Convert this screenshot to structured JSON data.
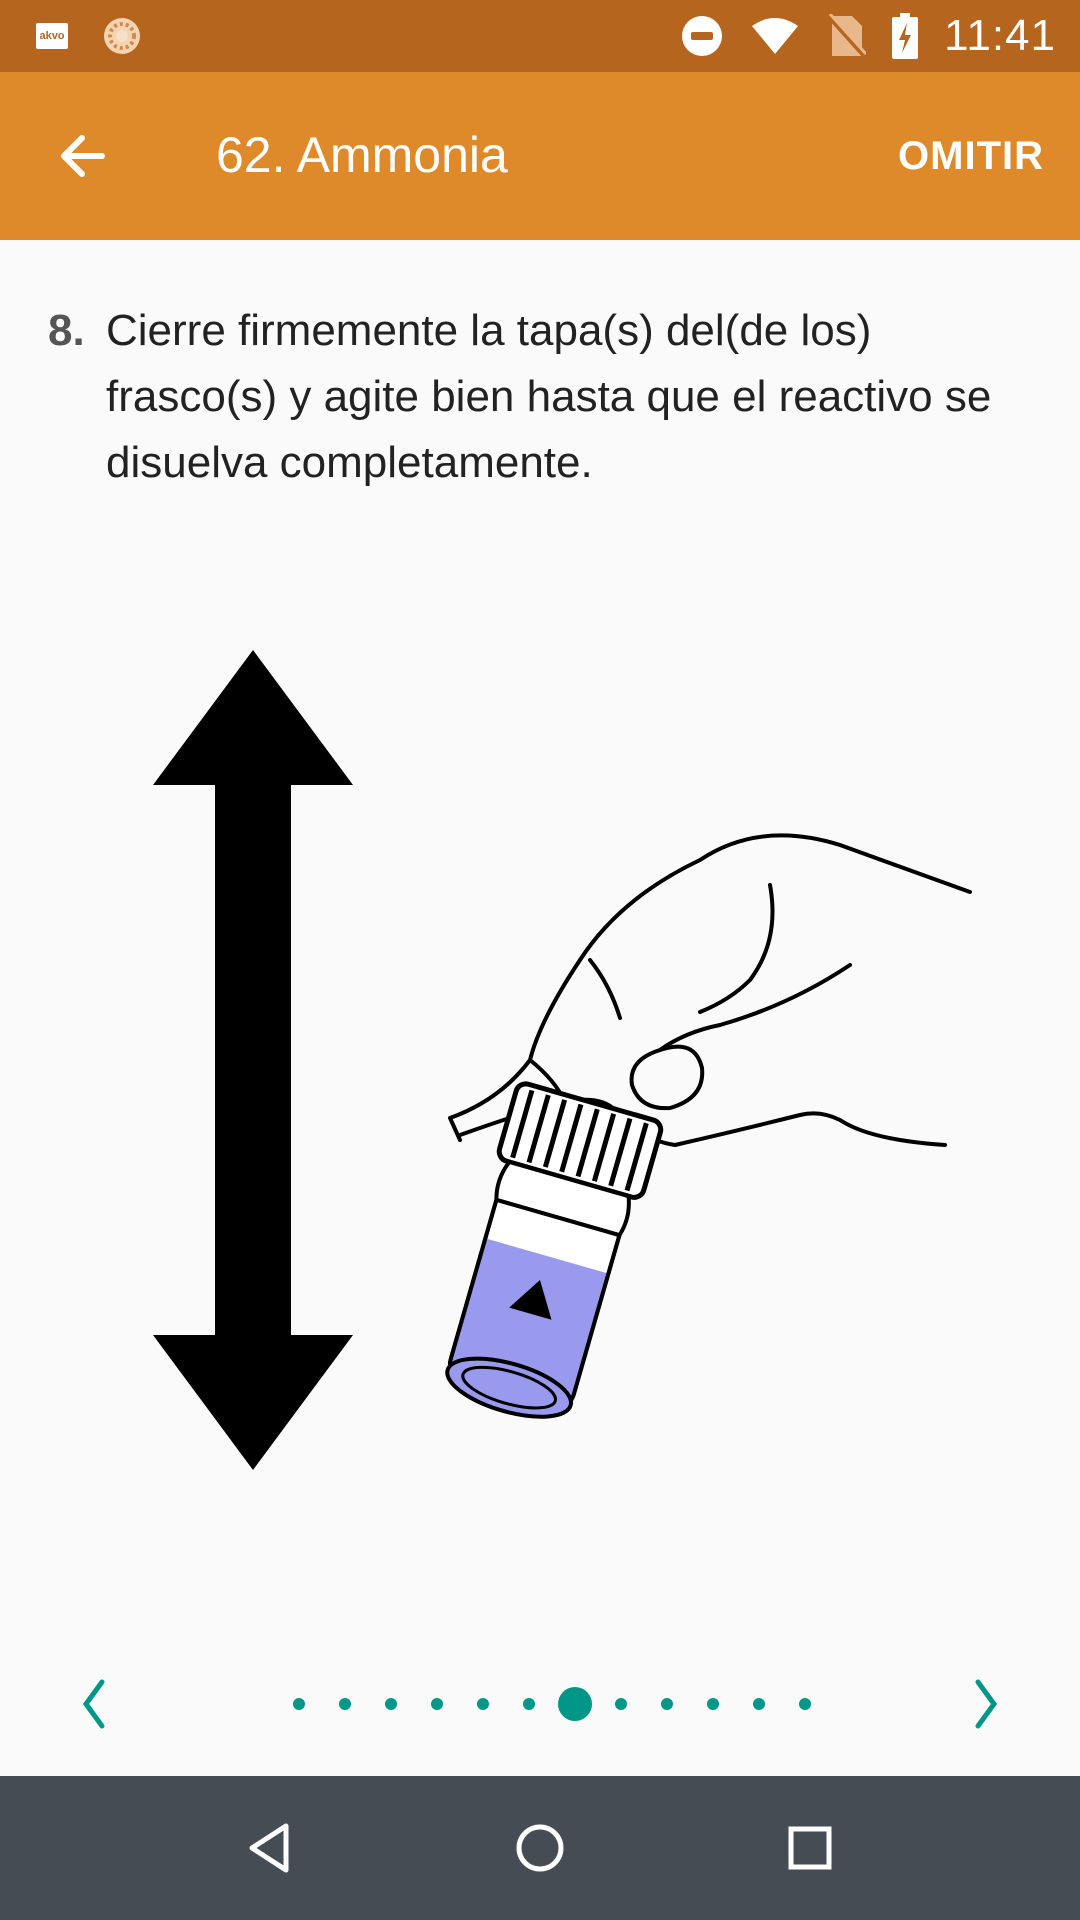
{
  "status_bar": {
    "time": "11:41",
    "app_icon_text": "akvo",
    "icons": [
      "akvo-app-icon",
      "sync-icon",
      "do-not-disturb-icon",
      "wifi-icon",
      "no-sim-icon",
      "battery-charging-icon"
    ]
  },
  "app_bar": {
    "title": "62. Ammonia",
    "skip_label": "OMITIR",
    "back_icon": "arrow-left-icon"
  },
  "instruction": {
    "number": "8.",
    "text": "Cierre firmemente la tapa(s) del(de los) frasco(s) y agite bien hasta que el reactivo se disuelva completamente."
  },
  "illustration": {
    "subject": "hand-shaking-vial",
    "liquid_color": "#9999ee"
  },
  "pager": {
    "total_pages": 12,
    "current_page": 7,
    "prev_icon": "chevron-left-icon",
    "next_icon": "chevron-right-icon",
    "accent_color": "#009688"
  },
  "colors": {
    "status_bar": "#b5651d",
    "app_bar": "#de8a2b",
    "background": "#fafafa",
    "nav_bar": "#464c54"
  },
  "nav_bar": {
    "icons": [
      "back-triangle-icon",
      "home-circle-icon",
      "recents-square-icon"
    ]
  }
}
